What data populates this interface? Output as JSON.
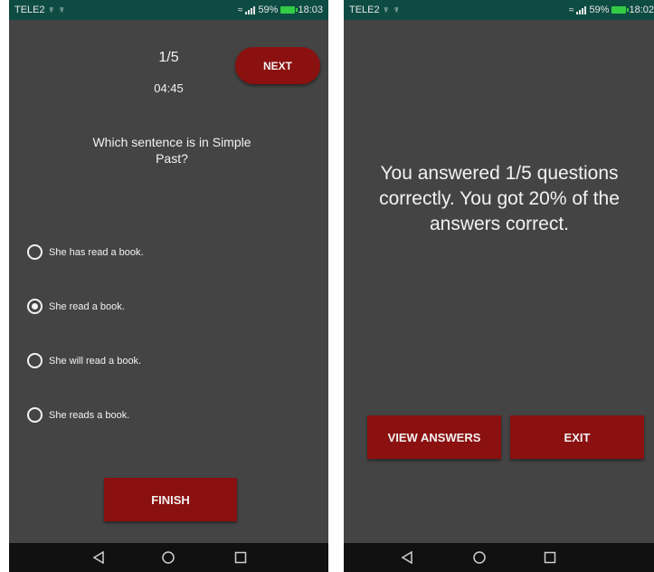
{
  "status_left": {
    "carrier": "TELE2 ♆ ♆",
    "battery": "59%",
    "time": "18:03"
  },
  "status_right": {
    "carrier": "TELE2 ♆ ♆",
    "battery": "59%",
    "time": "18:02"
  },
  "quiz": {
    "progress": "1/5",
    "timer": "04:45",
    "next_label": "NEXT",
    "question": "Which sentence is in Simple Past?",
    "options": [
      {
        "label": "She has read a book.",
        "selected": false
      },
      {
        "label": "She read a book.",
        "selected": true
      },
      {
        "label": "She will read a book.",
        "selected": false
      },
      {
        "label": "She reads a book.",
        "selected": false
      }
    ],
    "finish_label": "FINISH"
  },
  "results": {
    "message": "You answered 1/5 questions correctly. You got 20% of the answers correct.",
    "view_answers_label": "VIEW ANSWERS",
    "exit_label": "EXIT"
  },
  "icons": {
    "nav": [
      "back-icon",
      "home-icon",
      "recents-icon"
    ],
    "status": [
      "wifi-icon",
      "signal-icon",
      "battery-icon"
    ]
  },
  "colors": {
    "status_bar": "#0e4c43",
    "background": "#444444",
    "accent_red": "#8b1010",
    "battery_green": "#33cc44",
    "nav_bar": "#111111"
  }
}
